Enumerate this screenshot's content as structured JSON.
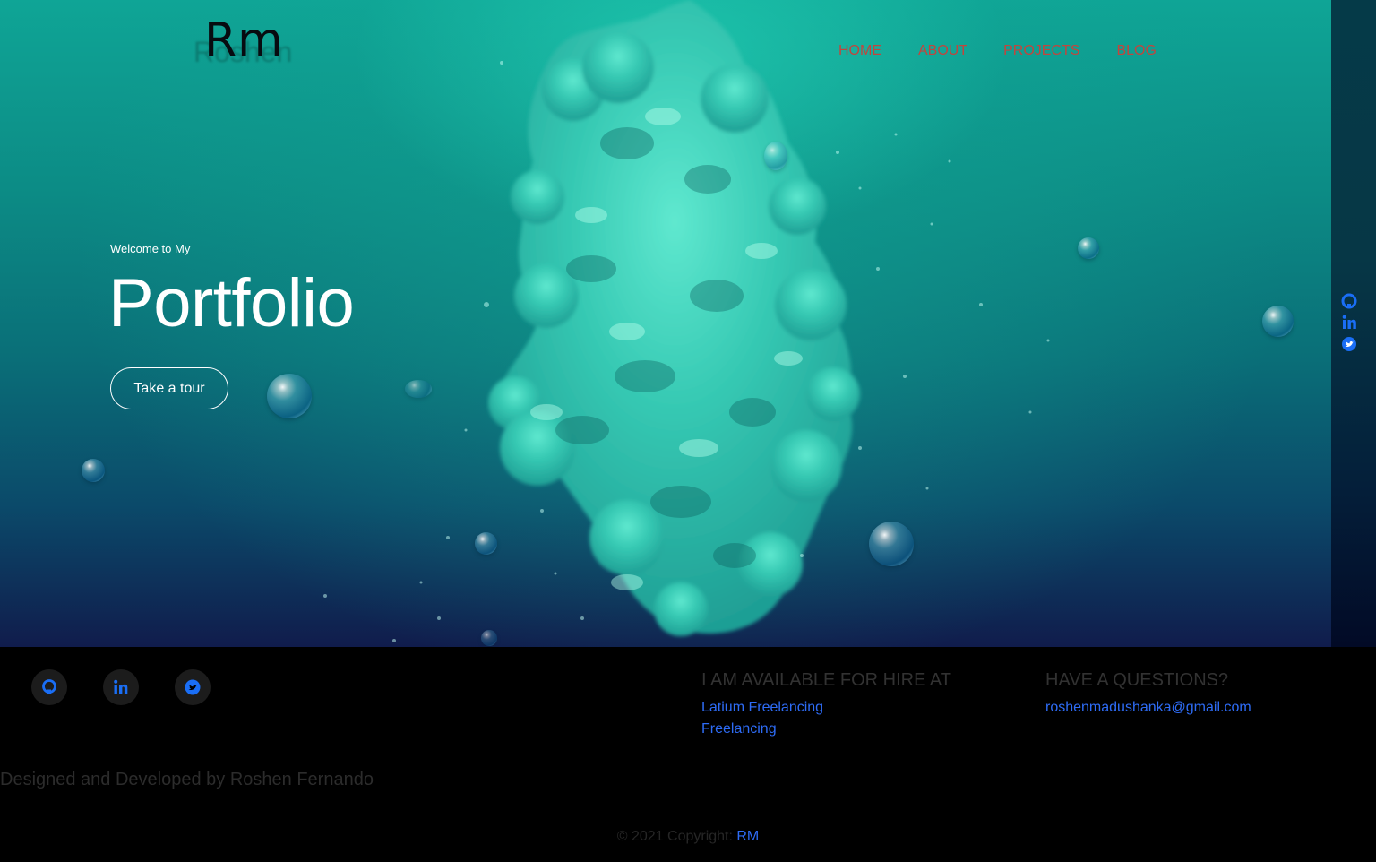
{
  "header": {
    "logo": "Rm",
    "logo_shadow": "Roshen",
    "nav": [
      {
        "label": "HOME"
      },
      {
        "label": "ABOUT"
      },
      {
        "label": "PROJECTS"
      },
      {
        "label": "BLOG"
      }
    ]
  },
  "hero": {
    "welcome": "Welcome to My",
    "title": "Portfolio",
    "button_label": "Take a tour"
  },
  "side_social": [
    "github-icon",
    "linkedin-icon",
    "twitter-icon"
  ],
  "footer": {
    "social": [
      "github-icon",
      "linkedin-icon",
      "twitter-icon"
    ],
    "hire": {
      "heading": "I AM AVAILABLE FOR HIRE AT",
      "links": [
        "Latium Freelancing",
        "Freelancing"
      ]
    },
    "questions": {
      "heading": "HAVE A QUESTIONS?",
      "email": "roshenmadushanka@gmail.com"
    },
    "credit": "Designed and Developed by Roshen Fernando",
    "copyright_text": "© 2021 Copyright: ",
    "copyright_link": "RM"
  },
  "colors": {
    "nav_text": "#c2453d",
    "link_blue": "#2e6cf6",
    "social_blue": "#1a6ef5",
    "hero_top": "#0fa596",
    "hero_bottom": "#101c4c"
  }
}
